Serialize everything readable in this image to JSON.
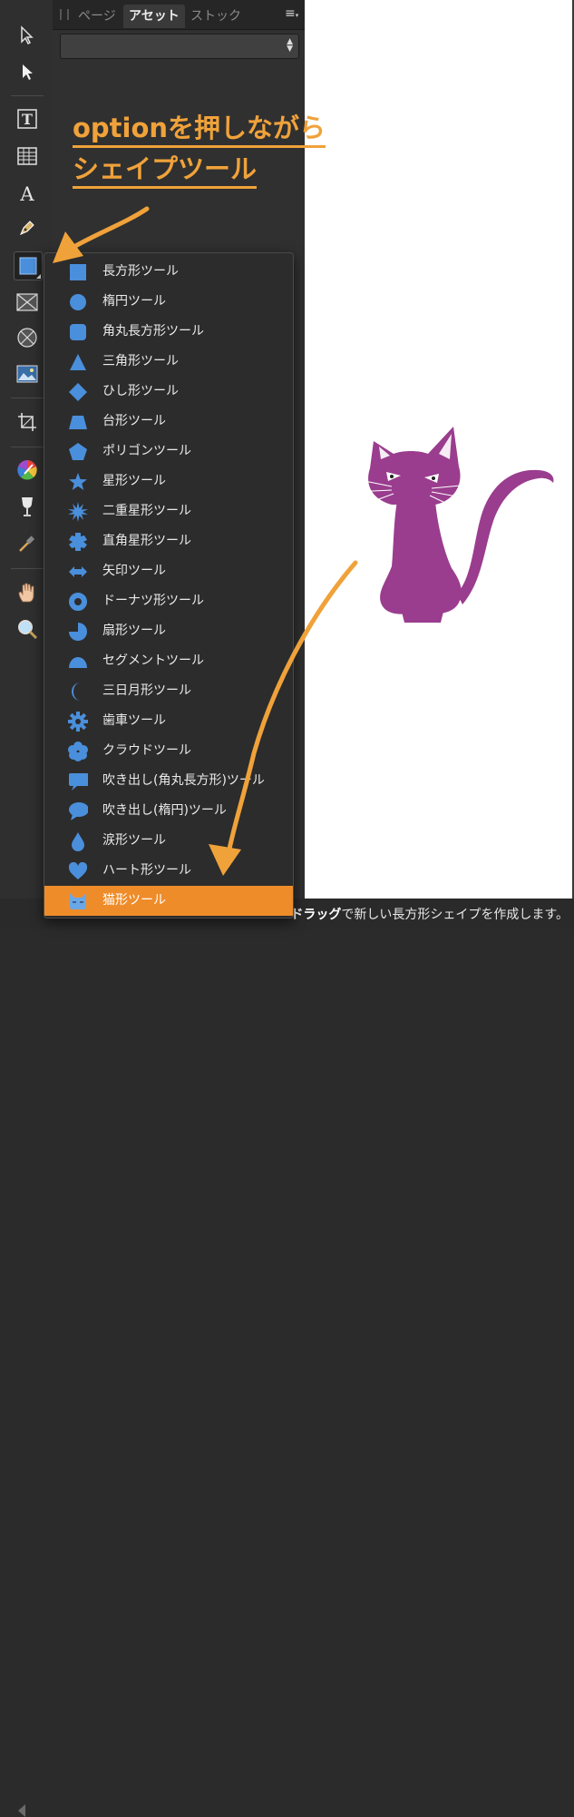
{
  "panel": {
    "tabs": [
      {
        "label": "ページ",
        "active": false
      },
      {
        "label": "アセット",
        "active": true
      },
      {
        "label": "ストック",
        "active": false
      }
    ],
    "dropdown_value": ""
  },
  "toolbar": {
    "tools": [
      {
        "name": "move-tool",
        "icon": "arrow-outline-icon"
      },
      {
        "name": "node-tool",
        "icon": "arrow-solid-icon"
      },
      {
        "name": "frame-text-tool",
        "icon": "text-frame-icon"
      },
      {
        "name": "table-tool",
        "icon": "table-icon"
      },
      {
        "name": "artistic-text-tool",
        "icon": "letter-a-icon"
      },
      {
        "name": "pen-tool",
        "icon": "pen-nib-icon"
      },
      {
        "name": "rectangle-tool",
        "icon": "square-icon"
      },
      {
        "name": "picture-frame-rect-tool",
        "icon": "cross-rect-icon"
      },
      {
        "name": "picture-frame-ellipse-tool",
        "icon": "cross-circle-icon"
      },
      {
        "name": "place-image-tool",
        "icon": "image-icon"
      },
      {
        "name": "crop-tool",
        "icon": "crop-icon"
      },
      {
        "name": "fill-tool",
        "icon": "color-wheel-icon"
      },
      {
        "name": "transparency-tool",
        "icon": "wine-glass-icon"
      },
      {
        "name": "color-picker-tool",
        "icon": "eyedropper-icon"
      },
      {
        "name": "view-tool",
        "icon": "hand-icon"
      },
      {
        "name": "zoom-tool",
        "icon": "magnifier-icon"
      }
    ]
  },
  "annotation": {
    "line1": "optionを押しながら",
    "line2": "シェイプツール"
  },
  "flyout": {
    "items": [
      {
        "label": "長方形ツール",
        "icon": "rectangle-icon"
      },
      {
        "label": "楕円ツール",
        "icon": "ellipse-icon"
      },
      {
        "label": "角丸長方形ツール",
        "icon": "rounded-rectangle-icon"
      },
      {
        "label": "三角形ツール",
        "icon": "triangle-icon"
      },
      {
        "label": "ひし形ツール",
        "icon": "diamond-icon"
      },
      {
        "label": "台形ツール",
        "icon": "trapezoid-icon"
      },
      {
        "label": "ポリゴンツール",
        "icon": "pentagon-icon"
      },
      {
        "label": "星形ツール",
        "icon": "star-icon"
      },
      {
        "label": "二重星形ツール",
        "icon": "double-star-icon"
      },
      {
        "label": "直角星形ツール",
        "icon": "square-star-icon"
      },
      {
        "label": "矢印ツール",
        "icon": "double-arrow-icon"
      },
      {
        "label": "ドーナツ形ツール",
        "icon": "donut-icon"
      },
      {
        "label": "扇形ツール",
        "icon": "pie-icon"
      },
      {
        "label": "セグメントツール",
        "icon": "segment-icon"
      },
      {
        "label": "三日月形ツール",
        "icon": "crescent-icon"
      },
      {
        "label": "歯車ツール",
        "icon": "cog-icon"
      },
      {
        "label": "クラウドツール",
        "icon": "cloud-icon"
      },
      {
        "label": "吹き出し(角丸長方形)ツール",
        "icon": "speech-bubble-rect-icon"
      },
      {
        "label": "吹き出し(楕円)ツール",
        "icon": "speech-bubble-ellipse-icon"
      },
      {
        "label": "涙形ツール",
        "icon": "teardrop-icon"
      },
      {
        "label": "ハート形ツール",
        "icon": "heart-icon"
      },
      {
        "label": "猫形ツール",
        "icon": "cat-icon",
        "selected": true
      }
    ]
  },
  "status": {
    "bold_part": "ドラッグ",
    "rest": "で新しい長方形シェイプを作成します。"
  },
  "colors": {
    "accent_orange": "#ef8c2a",
    "shape_blue": "#4a8fdb",
    "cat_purple": "#9a3d8e"
  }
}
